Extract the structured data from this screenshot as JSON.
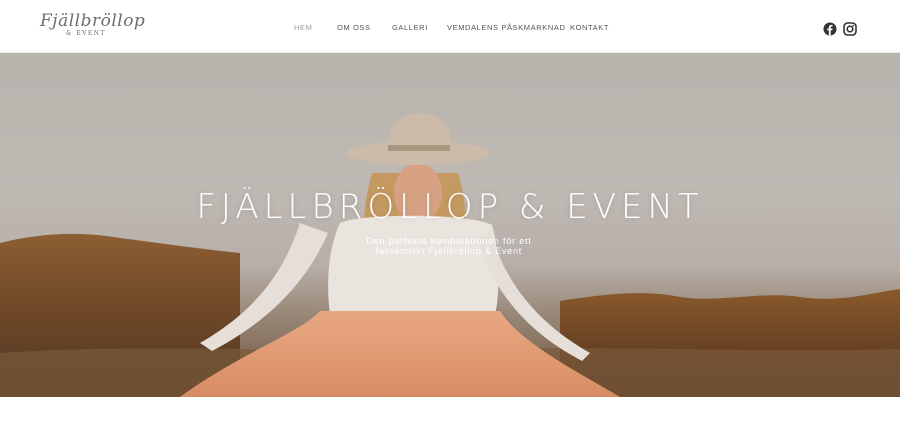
{
  "brand": {
    "logo_script": "Fjällbröllop",
    "logo_sub": "& EVENT"
  },
  "nav": {
    "items": [
      {
        "label": "HEM",
        "active": true
      },
      {
        "label": "OM OSS",
        "active": false
      },
      {
        "label": "GALLERI",
        "active": false
      },
      {
        "label": "VEMDALENS PÅSKMARKNAD",
        "active": false
      },
      {
        "label": "KONTAKT",
        "active": false
      }
    ]
  },
  "social": {
    "facebook_icon": "facebook-icon",
    "instagram_icon": "instagram-icon"
  },
  "hero": {
    "title": "FJÄLLBRÖLLOP & EVENT",
    "subtitle_line1": "Den perfekta kombinationen för ett",
    "subtitle_line2": "fantastiskt Fjällbröllop & Event"
  },
  "colors": {
    "nav_text": "#555555",
    "nav_active": "#9a9a9a",
    "hero_text": "#ffffff",
    "icon": "#333333"
  }
}
